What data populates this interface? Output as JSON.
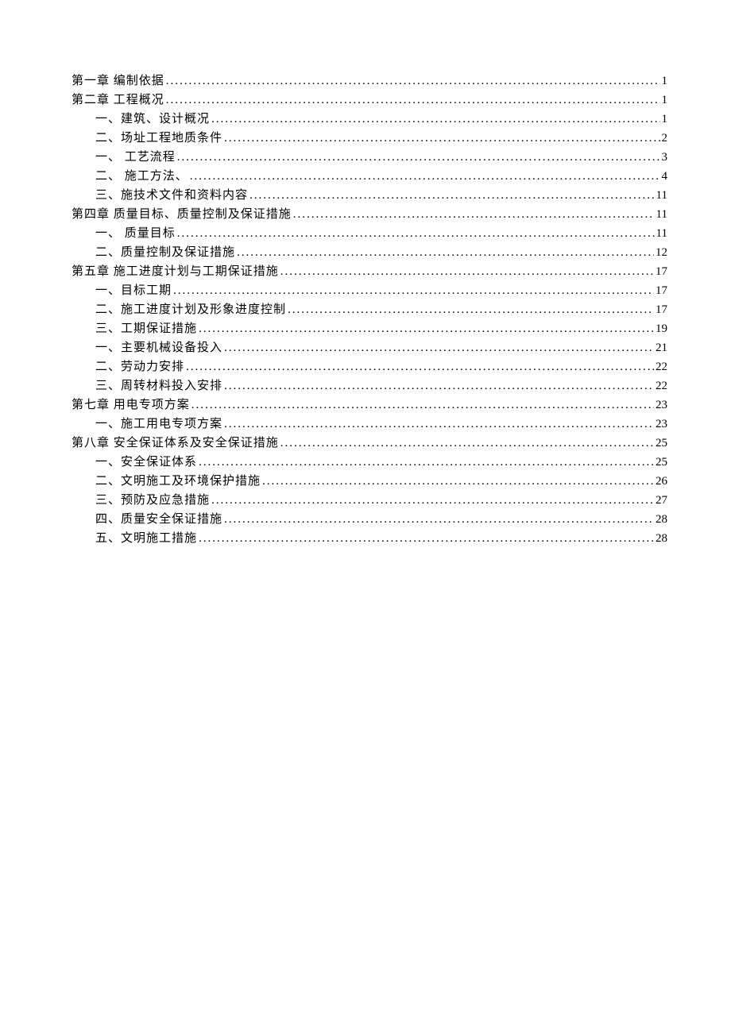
{
  "toc": [
    {
      "level": 1,
      "text": "第一章 编制依据",
      "page": "1"
    },
    {
      "level": 1,
      "text": "第二章 工程概况",
      "page": "1"
    },
    {
      "level": 2,
      "text": "一、建筑、设计概况",
      "page": "1"
    },
    {
      "level": 2,
      "text": "二、场址工程地质条件",
      "page": "2"
    },
    {
      "level": 2,
      "text": "一、 工艺流程",
      "page": "3"
    },
    {
      "level": 2,
      "text": "二、 施工方法、",
      "page": "4"
    },
    {
      "level": 2,
      "text": "三、施技术文件和资料内容",
      "page": "11"
    },
    {
      "level": 1,
      "text": "第四章 质量目标、质量控制及保证措施",
      "page": "11"
    },
    {
      "level": 2,
      "text": "一、 质量目标",
      "page": "11"
    },
    {
      "level": 2,
      "text": "二、质量控制及保证措施",
      "page": "12"
    },
    {
      "level": 1,
      "text": "第五章 施工进度计划与工期保证措施",
      "page": "17"
    },
    {
      "level": 2,
      "text": "一、目标工期",
      "page": "17"
    },
    {
      "level": 2,
      "text": "二、施工进度计划及形象进度控制",
      "page": "17"
    },
    {
      "level": 2,
      "text": "三、工期保证措施",
      "page": "19"
    },
    {
      "level": 2,
      "text": "一、主要机械设备投入",
      "page": "21"
    },
    {
      "level": 2,
      "text": "二、劳动力安排",
      "page": "22"
    },
    {
      "level": 2,
      "text": "三、周转材料投入安排",
      "page": "22"
    },
    {
      "level": 1,
      "text": "第七章 用电专项方案",
      "page": "23"
    },
    {
      "level": 2,
      "text": "一、施工用电专项方案",
      "page": "23"
    },
    {
      "level": 1,
      "text": "第八章 安全保证体系及安全保证措施",
      "page": "25"
    },
    {
      "level": 2,
      "text": "一、安全保证体系",
      "page": "25"
    },
    {
      "level": 2,
      "text": "二、文明施工及环境保护措施",
      "page": "26"
    },
    {
      "level": 2,
      "text": "三、预防及应急措施",
      "page": "27"
    },
    {
      "level": 2,
      "text": "四、质量安全保证措施",
      "page": "28"
    },
    {
      "level": 2,
      "text": "五、文明施工措施",
      "page": "28"
    }
  ]
}
